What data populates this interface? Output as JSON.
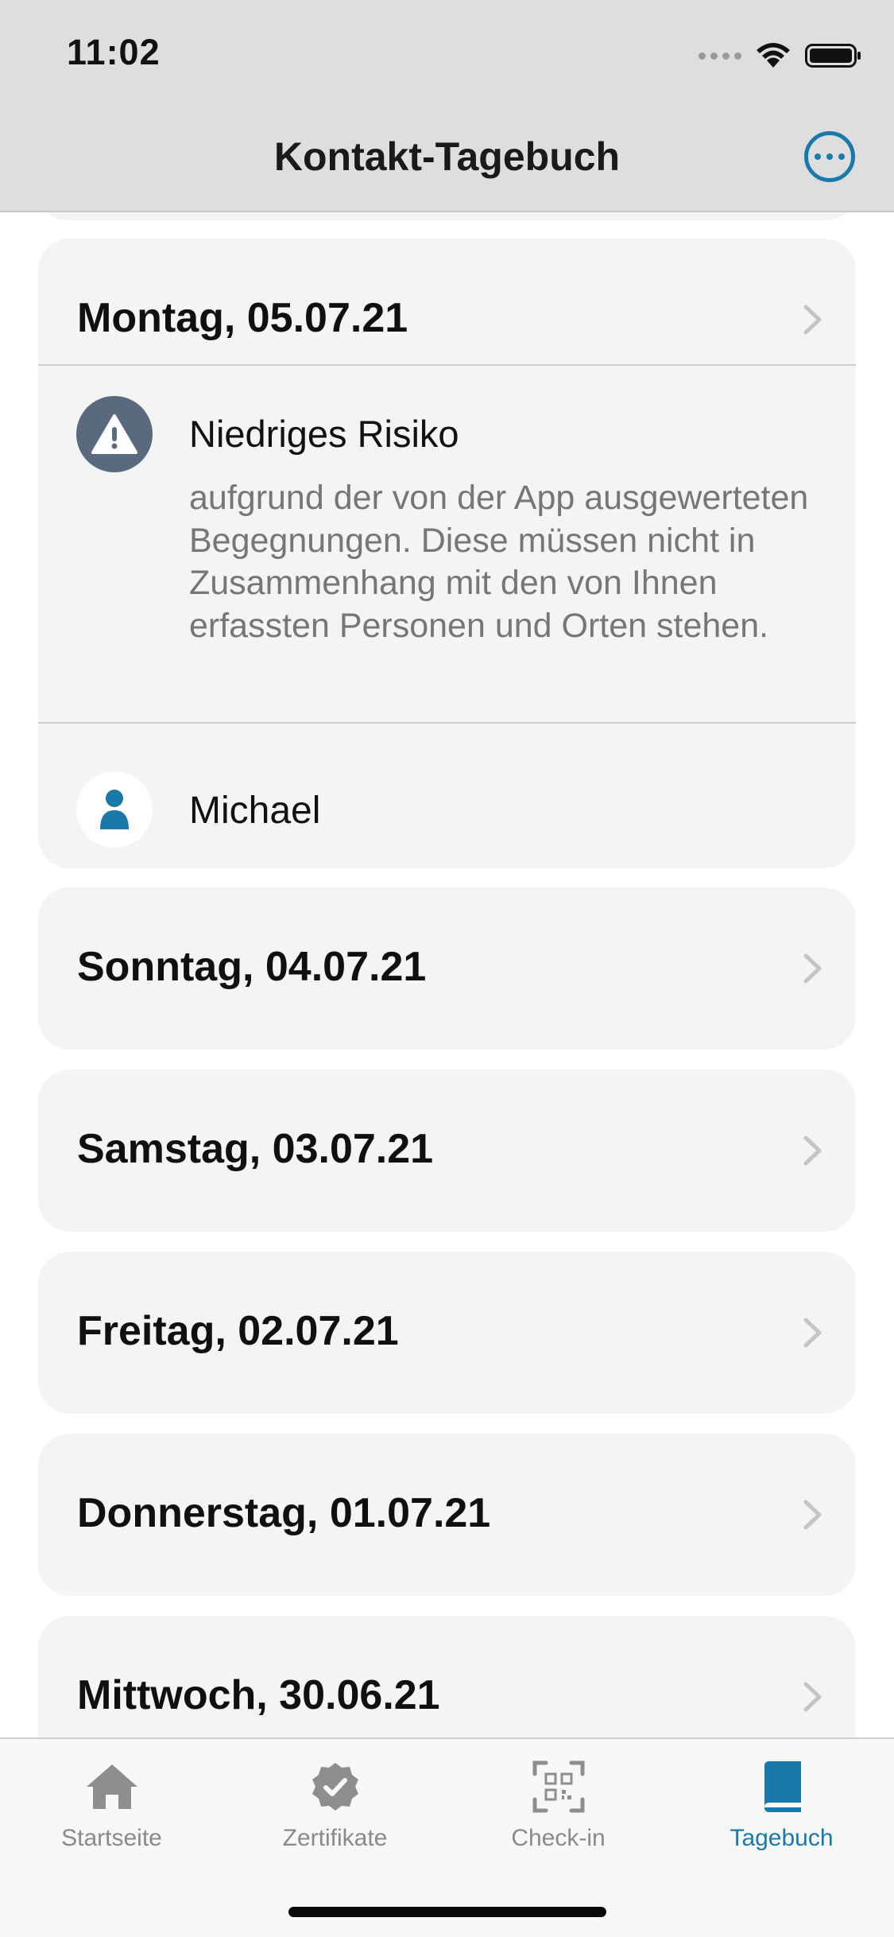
{
  "status_bar": {
    "time": "11:02"
  },
  "nav": {
    "title": "Kontakt-Tagebuch",
    "more_icon": "ellipsis-circle-icon"
  },
  "colors": {
    "accent": "#1979a8",
    "card_background": "#f4f4f4",
    "risk_icon_background": "#5a6a7e",
    "secondary_text": "#767676"
  },
  "expanded_day": {
    "date": "Montag, 05.07.21",
    "risk": {
      "icon": "warning-triangle-icon",
      "title": "Niedriges Risiko",
      "description": "aufgrund der von der App ausgewerteten Begegnungen. Diese müssen nicht in Zusammenhang mit den von Ihnen erfassten Personen und Orten stehen."
    },
    "entries": [
      {
        "icon": "person-icon",
        "name": "Michael"
      }
    ]
  },
  "days": [
    {
      "date": "Sonntag, 04.07.21"
    },
    {
      "date": "Samstag, 03.07.21"
    },
    {
      "date": "Freitag, 02.07.21"
    },
    {
      "date": "Donnerstag, 01.07.21"
    },
    {
      "date": "Mittwoch, 30.06.21"
    }
  ],
  "tabs": [
    {
      "label": "Startseite",
      "icon": "house-icon",
      "active": false
    },
    {
      "label": "Zertifikate",
      "icon": "certificate-check-icon",
      "active": false
    },
    {
      "label": "Check-in",
      "icon": "qr-scan-icon",
      "active": false
    },
    {
      "label": "Tagebuch",
      "icon": "book-icon",
      "active": true
    }
  ]
}
